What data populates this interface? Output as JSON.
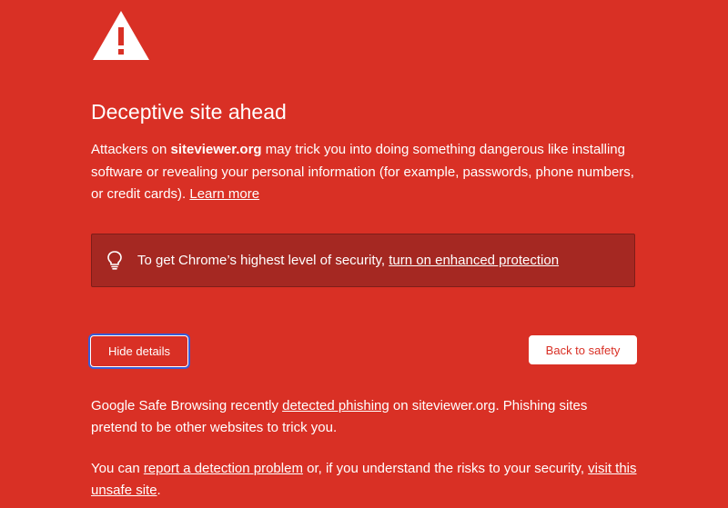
{
  "icons": {
    "warning": "warning-triangle-icon",
    "bulb": "lightbulb-icon"
  },
  "colors": {
    "background": "#d93025",
    "box_background": "#a52822",
    "text": "#ffffff",
    "focus_ring": "#3b5bd4"
  },
  "heading": {
    "title": "Deceptive site ahead"
  },
  "intro": {
    "prefix": "Attackers on ",
    "site": "siteviewer.org",
    "body": " may trick you into doing something dangerous like installing software or revealing your personal information (for example, passwords, phone numbers, or credit cards). ",
    "learn_more": "Learn more"
  },
  "enhanced": {
    "text": "To get Chrome’s highest level of security, ",
    "link": "turn on enhanced protection"
  },
  "buttons": {
    "hide_details": "Hide details",
    "back_to_safety": "Back to safety"
  },
  "details": {
    "p1_prefix": "Google Safe Browsing recently ",
    "p1_link": "detected phishing",
    "p1_suffix": " on siteviewer.org. Phishing sites pretend to be other websites to trick you.",
    "p2_prefix": "You can ",
    "p2_link1": "report a detection problem",
    "p2_middle": " or, if you understand the risks to your security, ",
    "p2_link2": "visit this unsafe site",
    "p2_suffix": "."
  }
}
